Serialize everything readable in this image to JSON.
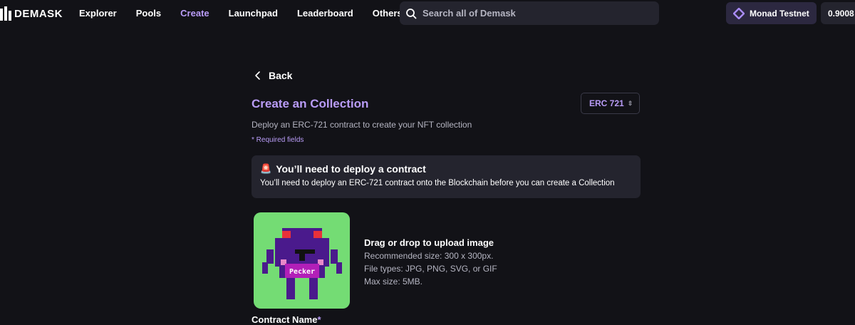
{
  "header": {
    "brand": "DEMASK",
    "nav": [
      {
        "label": "Explorer",
        "active": false
      },
      {
        "label": "Pools",
        "active": false
      },
      {
        "label": "Create",
        "active": true
      },
      {
        "label": "Launchpad",
        "active": false
      },
      {
        "label": "Leaderboard",
        "active": false
      },
      {
        "label": "Others",
        "active": false
      }
    ],
    "search_placeholder": "Search all of Demask",
    "network_label": "Monad Testnet",
    "balance": "0.9008"
  },
  "page": {
    "back_label": "Back",
    "title": "Create an Collection",
    "standard_select": "ERC 721",
    "subtitle": "Deploy an ERC-721 contract to create your NFT collection",
    "required_note": "* Required fields"
  },
  "notice": {
    "icon": "siren-icon",
    "title": "You’ll need to deploy a contract",
    "body": "You’ll need to deploy an ERC-721 contract onto the Blockchain before you can create a Collection"
  },
  "upload": {
    "image_caption": "Pecker",
    "title": "Drag or drop to upload image",
    "lines": [
      "Recommended size: 300 x 300px.",
      "File types: JPG, PNG, SVG, or GIF",
      "Max size: 5MB."
    ]
  },
  "form": {
    "contract_name_label": "Contract Name",
    "required_marker": "*"
  },
  "colors": {
    "background": "#121217",
    "accent": "#b99cf7",
    "panel": "#24242e",
    "upload_bg": "#74dc74"
  }
}
